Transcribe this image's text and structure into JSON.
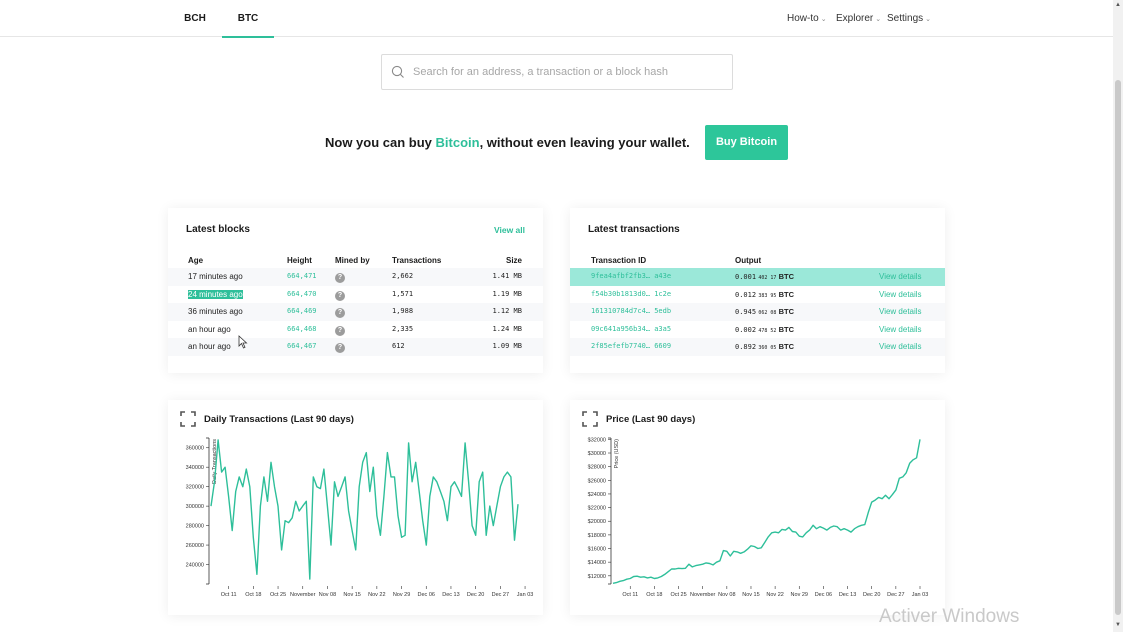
{
  "nav": {
    "tabs": [
      {
        "label": "BCH",
        "active": false
      },
      {
        "label": "BTC",
        "active": true
      }
    ],
    "menus": [
      {
        "label": "How-to"
      },
      {
        "label": "Explorer"
      },
      {
        "label": "Settings"
      }
    ],
    "accent_color": "#2ebf9a"
  },
  "search": {
    "placeholder": "Search for an address, a transaction or a block hash",
    "value": ""
  },
  "promo": {
    "text_before": "Now you can buy ",
    "highlight": "Bitcoin",
    "text_after": ", without even leaving your wallet.",
    "button_label": "Buy Bitcoin"
  },
  "latest_blocks": {
    "title": "Latest blocks",
    "view_all": "View all",
    "columns": [
      "Age",
      "Height",
      "Mined by",
      "Transactions",
      "Size"
    ],
    "rows": [
      {
        "age": "17 minutes ago",
        "height": "664,471",
        "mined_by": "?",
        "transactions": "2,662",
        "size": "1.41 MB"
      },
      {
        "age": "24 minutes ago",
        "height": "664,470",
        "mined_by": "?",
        "transactions": "1,571",
        "size": "1.19 MB",
        "selected": true
      },
      {
        "age": "36 minutes ago",
        "height": "664,469",
        "mined_by": "?",
        "transactions": "1,988",
        "size": "1.12 MB"
      },
      {
        "age": "an hour ago",
        "height": "664,468",
        "mined_by": "?",
        "transactions": "2,335",
        "size": "1.24 MB"
      },
      {
        "age": "an hour ago",
        "height": "664,467",
        "mined_by": "?",
        "transactions": "612",
        "size": "1.09 MB"
      }
    ]
  },
  "latest_transactions": {
    "title": "Latest transactions",
    "columns": [
      "Transaction ID",
      "Output"
    ],
    "rows": [
      {
        "id": "9fea4afbf2fb3… a43e",
        "out_main": "0.001",
        "out_small": "402 17",
        "unit": "BTC",
        "action": "View details",
        "highlighted": true
      },
      {
        "id": "f54b30b1813d0… 1c2e",
        "out_main": "0.012",
        "out_small": "383 95",
        "unit": "BTC",
        "action": "View details"
      },
      {
        "id": "161310784d7c4… 5edb",
        "out_main": "0.945",
        "out_small": "062 08",
        "unit": "BTC",
        "action": "View details"
      },
      {
        "id": "09c641a956b34… a3a5",
        "out_main": "0.002",
        "out_small": "478 52",
        "unit": "BTC",
        "action": "View details"
      },
      {
        "id": "2f85efefb7740… 6609",
        "out_main": "0.892",
        "out_small": "360 05",
        "unit": "BTC",
        "action": "View details"
      }
    ]
  },
  "chart_data": [
    {
      "type": "line",
      "title": "Daily Transactions (Last 90 days)",
      "ylabel": "Daily Transactions",
      "xlabel": "",
      "ylim": [
        220000,
        370000
      ],
      "yticks": [
        240000,
        260000,
        280000,
        300000,
        320000,
        340000,
        360000
      ],
      "ytick_labels": [
        "240000",
        "260000",
        "280000",
        "300000",
        "320000",
        "340000",
        "360000"
      ],
      "xtick_labels": [
        "Oct 11",
        "Oct 18",
        "Oct 25",
        "November",
        "Nov 08",
        "Nov 15",
        "Nov 22",
        "Nov 29",
        "Dec 06",
        "Dec 13",
        "Dec 20",
        "Dec 27",
        "Jan 03"
      ],
      "xtick_positions": [
        6,
        13,
        20,
        27,
        34,
        41,
        48,
        55,
        62,
        69,
        76,
        83,
        90
      ],
      "color": "#2ebf9a",
      "values": [
        300000,
        325000,
        368000,
        335000,
        340000,
        310000,
        275000,
        315000,
        330000,
        320000,
        338000,
        320000,
        268000,
        230000,
        300000,
        330000,
        305000,
        345000,
        320000,
        300000,
        255000,
        285000,
        283000,
        288000,
        305000,
        295000,
        300000,
        305000,
        225000,
        330000,
        320000,
        318000,
        338000,
        300000,
        260000,
        325000,
        310000,
        320000,
        330000,
        295000,
        275000,
        255000,
        320000,
        345000,
        355000,
        315000,
        340000,
        290000,
        270000,
        310000,
        355000,
        330000,
        330000,
        290000,
        268000,
        270000,
        365000,
        325000,
        345000,
        315000,
        285000,
        260000,
        310000,
        330000,
        325000,
        315000,
        305000,
        285000,
        320000,
        325000,
        318000,
        310000,
        365000,
        325000,
        280000,
        270000,
        325000,
        335000,
        270000,
        300000,
        280000,
        300000,
        320000,
        330000,
        335000,
        330000,
        265000,
        302000
      ]
    },
    {
      "type": "line",
      "title": "Price (Last 90 days)",
      "ylabel": "Price (USD)",
      "xlabel": "",
      "ylim": [
        10800,
        32200
      ],
      "yticks": [
        12000,
        14000,
        16000,
        18000,
        20000,
        22000,
        24000,
        26000,
        28000,
        30000,
        32000
      ],
      "ytick_labels": [
        "$12000",
        "$14000",
        "$16000",
        "$18000",
        "$20000",
        "$22000",
        "$24000",
        "$26000",
        "$28000",
        "$30000",
        "$32000"
      ],
      "xtick_labels": [
        "Oct 11",
        "Oct 18",
        "Oct 25",
        "November",
        "Nov 08",
        "Nov 15",
        "Nov 22",
        "Nov 29",
        "Dec 06",
        "Dec 13",
        "Dec 20",
        "Dec 27",
        "Jan 03"
      ],
      "xtick_positions": [
        6,
        13,
        20,
        27,
        34,
        41,
        48,
        55,
        62,
        69,
        76,
        83,
        90
      ],
      "color": "#2ebf9a",
      "values": [
        10900,
        11000,
        11200,
        11300,
        11500,
        11600,
        11900,
        11950,
        11800,
        11850,
        11700,
        11800,
        11600,
        11700,
        11900,
        12200,
        12600,
        13000,
        13000,
        13100,
        13050,
        13100,
        13700,
        13300,
        13500,
        13600,
        13700,
        13900,
        13800,
        13600,
        14000,
        14200,
        15700,
        15600,
        14900,
        15600,
        15500,
        15300,
        15500,
        15900,
        16400,
        16300,
        16000,
        16100,
        16900,
        17700,
        18300,
        18400,
        18300,
        18800,
        18700,
        19100,
        18500,
        18400,
        17800,
        17700,
        18300,
        18700,
        19400,
        18900,
        19200,
        19000,
        18700,
        19100,
        19300,
        19200,
        18700,
        18900,
        18700,
        18400,
        18900,
        19200,
        19400,
        19500,
        21300,
        22800,
        23100,
        23500,
        23300,
        23800,
        23300,
        23900,
        24600,
        26300,
        26500,
        27100,
        28500,
        29000,
        29300,
        32000
      ]
    }
  ],
  "watermark": "Activer Windows"
}
